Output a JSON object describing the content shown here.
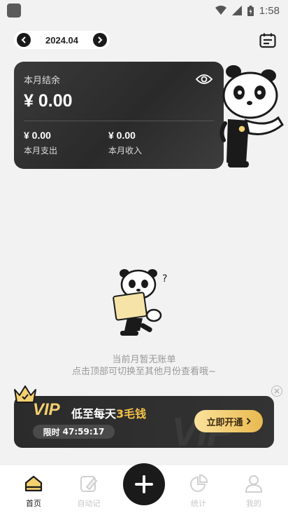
{
  "status_bar": {
    "time": "1:58"
  },
  "header": {
    "month": "2024.04"
  },
  "card": {
    "title": "本月结余",
    "balance": "¥ 0.00",
    "expense_amount": "¥ 0.00",
    "expense_label": "本月支出",
    "income_amount": "¥ 0.00",
    "income_label": "本月收入"
  },
  "empty_state": {
    "title": "当前月暂无账单",
    "hint": "点击顶部可切换至其他月份查看哦~"
  },
  "vip": {
    "word": "VIP",
    "slogan_pre": "低至每天",
    "slogan_price": "3毛钱",
    "timer_label": "限时",
    "timer_value": "47:59:17",
    "cta": "立即开通",
    "watermark": "VIP"
  },
  "tabs": [
    {
      "label": "首页",
      "icon": "home-icon",
      "active": true
    },
    {
      "label": "自动记",
      "icon": "auto-note-icon",
      "active": false
    },
    {
      "label": "统计",
      "icon": "pie-chart-icon",
      "active": false
    },
    {
      "label": "我的",
      "icon": "user-icon",
      "active": false
    }
  ],
  "colors": {
    "accent": "#f4d06f",
    "dark": "#1a1a1a",
    "background": "#f2f2f2"
  }
}
